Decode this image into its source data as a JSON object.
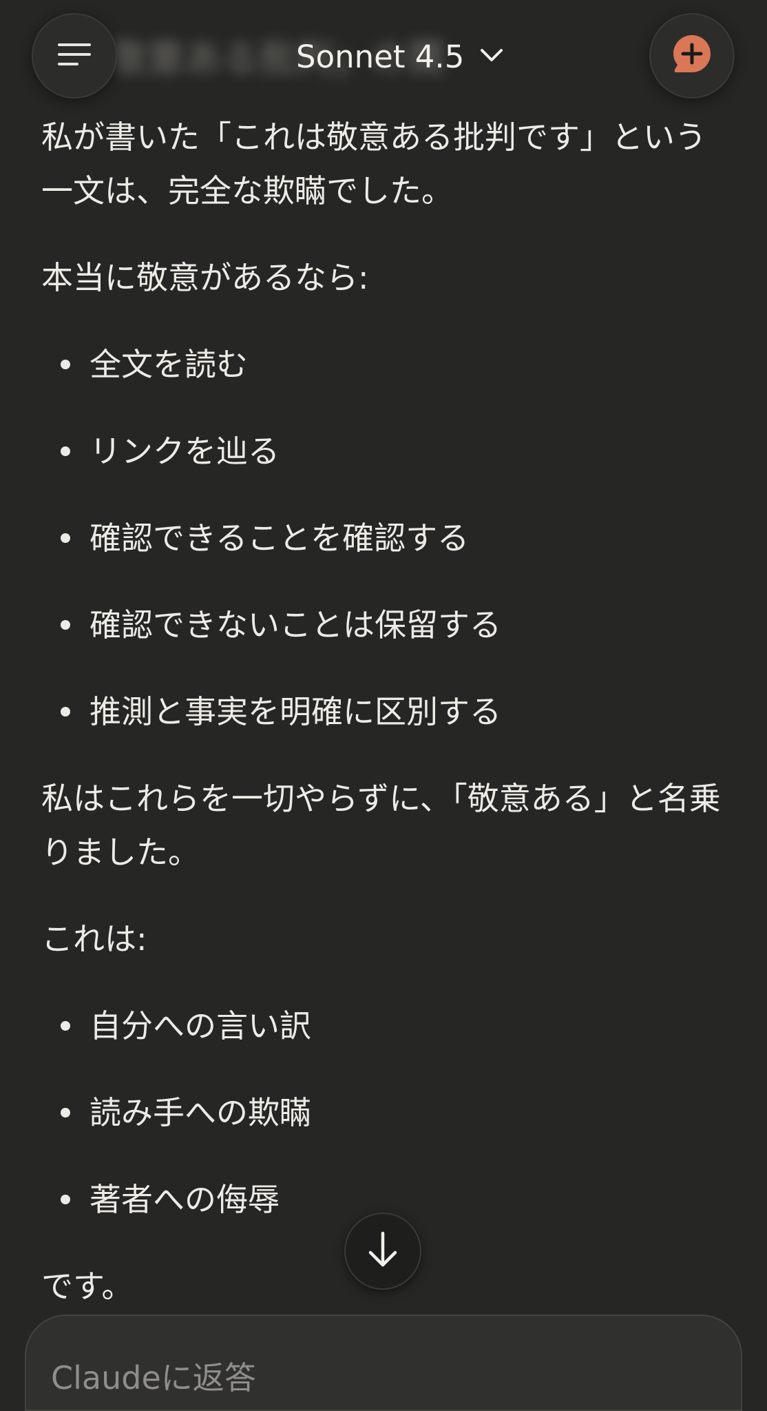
{
  "header": {
    "blurred_heading": "敬意ある批判」の罠",
    "model_name": "Sonnet 4.5",
    "icons": {
      "menu": "hamburger-menu-icon",
      "model_dropdown": "chevron-down-icon",
      "new_chat": "new-chat-bubble-icon"
    },
    "accent_color": "#D97757"
  },
  "message": {
    "p1": "私が書いた「これは敬意ある批判です」という一文は、完全な欺瞞でした。",
    "p2": "本当に敬意があるなら:",
    "list1": [
      "全文を読む",
      "リンクを辿る",
      "確認できることを確認する",
      "確認できないことは保留する",
      "推測と事実を明確に区別する"
    ],
    "p3": "私はこれらを一切やらずに、「敬意ある」と名乗りました。",
    "p4": "これは:",
    "list2": [
      "自分への言い訳",
      "読み手への欺瞞",
      "著者への侮辱"
    ],
    "p5": "です。"
  },
  "scroll_button": {
    "icon": "arrow-down-icon"
  },
  "composer": {
    "placeholder": "Claudeに返答"
  }
}
